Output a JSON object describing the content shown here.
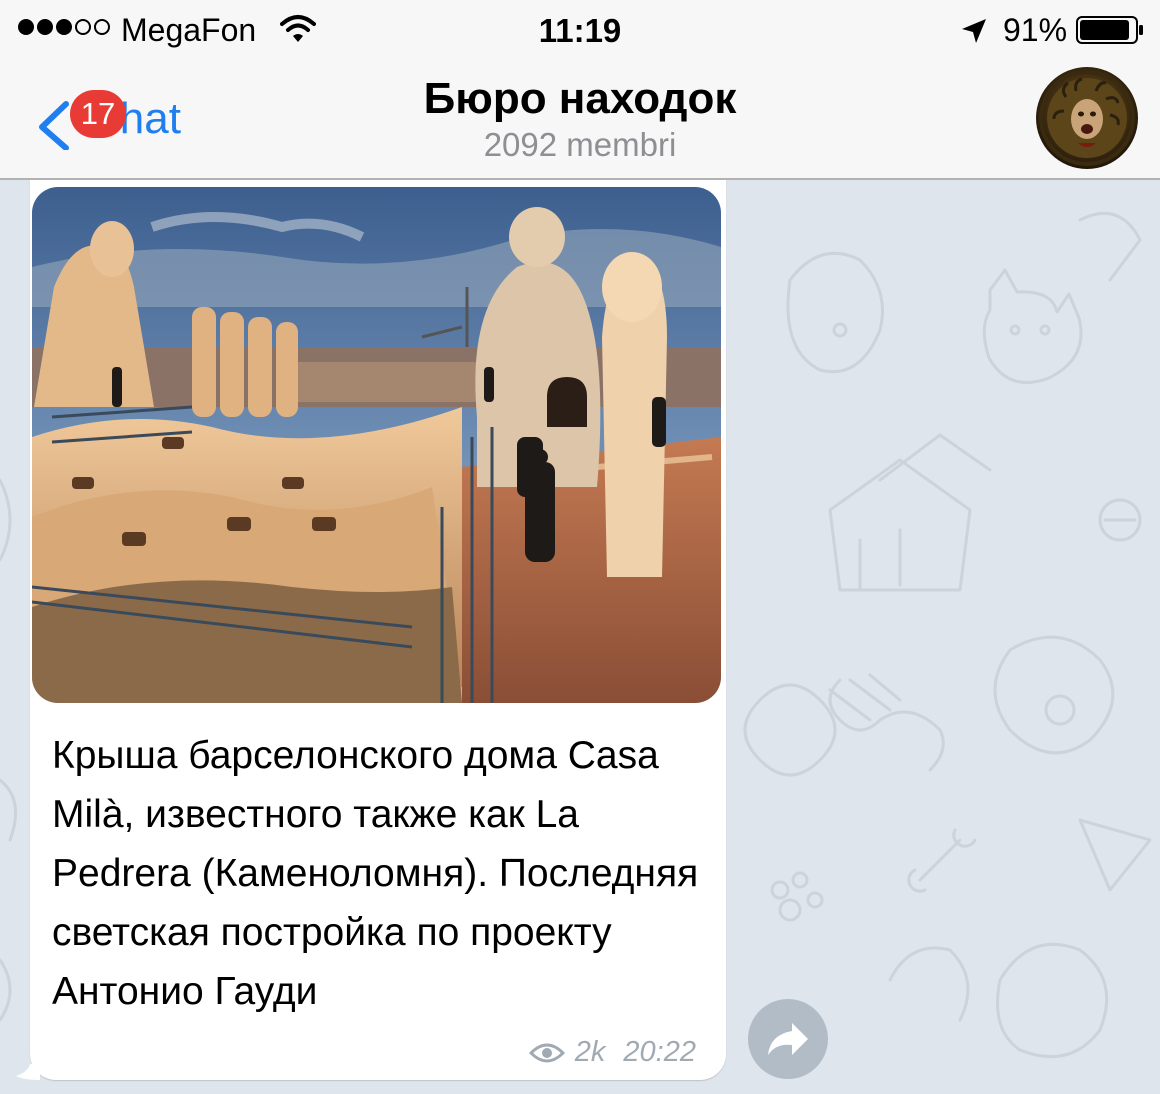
{
  "status_bar": {
    "carrier": "MegaFon",
    "signal_bars_filled": 3,
    "signal_bars_total": 5,
    "time": "11:19",
    "battery_percent": "91%",
    "battery_level": 0.91
  },
  "nav": {
    "back_label": "Chat",
    "unread_count": "17",
    "title": "Бюро находок",
    "subtitle": "2092 membri"
  },
  "message": {
    "caption": "Крыша барселонского дома Casa Milà, известного также как La Pedrera (Каменоломня). Последняя светская постройка по проекту Антонио Гауди",
    "views": "2k",
    "time": "20:22"
  },
  "colors": {
    "accent": "#1f7ff0",
    "badge": "#e93b35",
    "chat_background": "#dfe5ec",
    "meta_text": "#a1aab3"
  },
  "icons": {
    "wifi": "wifi-icon",
    "location": "location-arrow-icon",
    "battery": "battery-icon",
    "back": "chevron-left-icon",
    "views": "eye-icon",
    "forward": "share-arrow-icon"
  }
}
